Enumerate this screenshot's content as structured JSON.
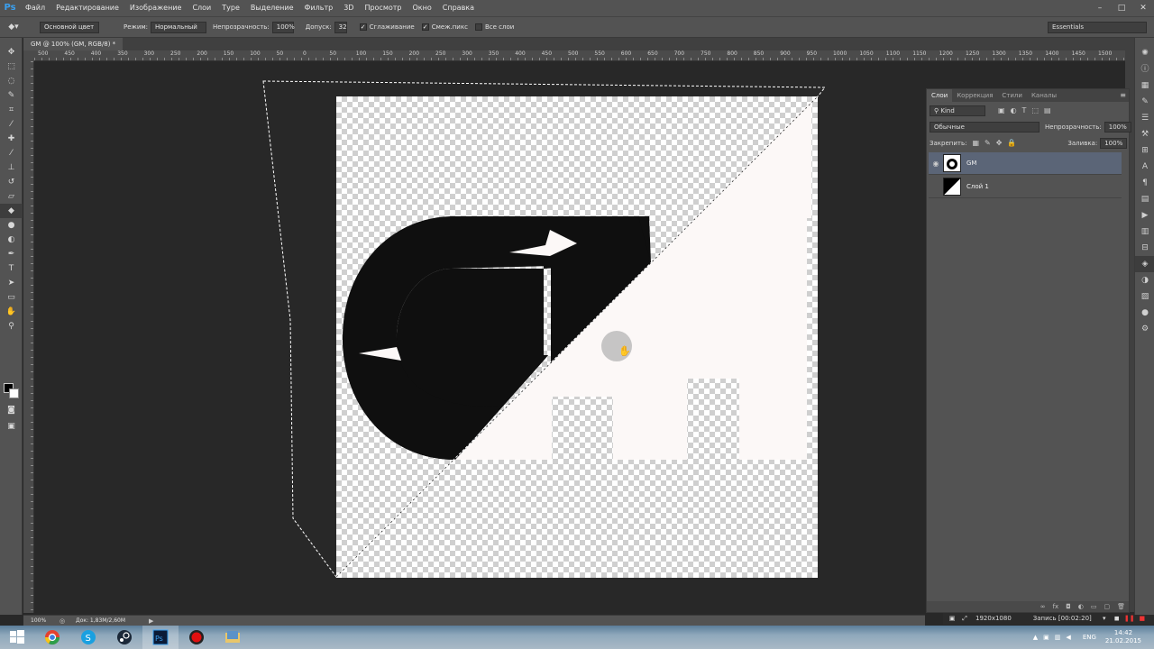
{
  "app": {
    "logo": "Ps"
  },
  "menu": [
    "Файл",
    "Редактирование",
    "Изображение",
    "Слои",
    "Туре",
    "Выделение",
    "Фильтр",
    "3D",
    "Просмотр",
    "Окно",
    "Справка"
  ],
  "window_controls": [
    "–",
    "□",
    "✕"
  ],
  "options": {
    "fill_source": "Основной цвет",
    "mode_label": "Режим:",
    "mode_value": "Нормальный",
    "opacity_label": "Непрозрачность:",
    "opacity_value": "100%",
    "tolerance_label": "Допуск:",
    "tolerance_value": "32",
    "antialias": "Сглаживание",
    "contiguous": "Смеж.пикс",
    "all_layers": "Все слои",
    "workspace": "Essentials"
  },
  "document": {
    "tab_title": "GM @ 100% (GM, RGB/8) *",
    "zoom": "100%",
    "info": "Док: 1,83M/2,60M"
  },
  "ruler_labels": [
    "500",
    "450",
    "400",
    "350",
    "300",
    "250",
    "200",
    "150",
    "100",
    "50",
    "0",
    "50",
    "100",
    "150",
    "200",
    "250",
    "300",
    "350",
    "400",
    "450",
    "500",
    "550",
    "600",
    "650",
    "700",
    "750",
    "800",
    "850",
    "900",
    "950",
    "1000",
    "1050",
    "1100",
    "1150",
    "1200",
    "1250",
    "1300",
    "1350",
    "1400",
    "1450",
    "1500"
  ],
  "layers_panel": {
    "tabs": [
      "Слои",
      "Коррекция",
      "Стили",
      "Каналы"
    ],
    "filter": "Kind",
    "blend_mode": "Обычные",
    "opacity_label": "Непрозрачность:",
    "opacity_value": "100%",
    "lock_label": "Закрепить:",
    "fill_label": "Заливка:",
    "fill_value": "100%",
    "layers": [
      {
        "name": "GM",
        "selected": true,
        "visible": true
      },
      {
        "name": "Слой 1",
        "selected": false,
        "visible": false
      }
    ]
  },
  "recorder": {
    "resolution": "1920x1080",
    "time": "Запись [00:02:20]"
  },
  "taskbar": {
    "lang": "ENG",
    "time": "14:42",
    "date": "21.02.2015"
  }
}
